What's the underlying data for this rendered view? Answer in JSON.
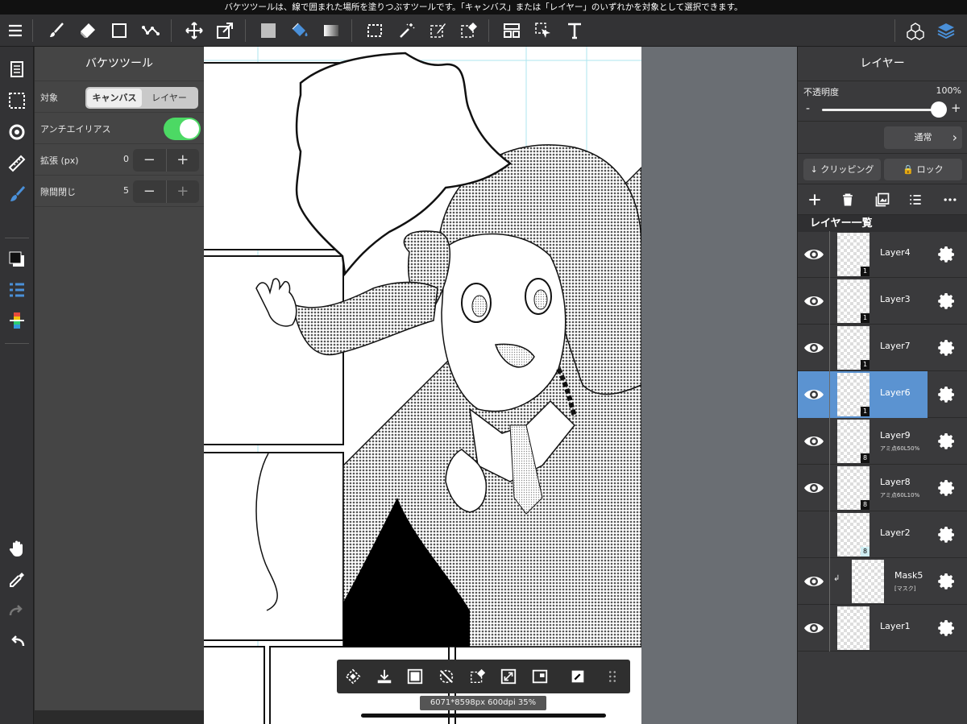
{
  "tooltip": "バケツツールは、線で囲まれた場所を塗りつぶすツールです。「キャンバス」または「レイヤー」のいずれかを対象として選択できます。",
  "tool_panel": {
    "title": "バケツツール",
    "target_label": "対象",
    "target_options": [
      "キャンバス",
      "レイヤー"
    ],
    "target_selected": "キャンバス",
    "antialias_label": "アンチエイリアス",
    "antialias_on": true,
    "expand_label": "拡張 (px)",
    "expand_value": "0",
    "gap_label": "隙間閉じ",
    "gap_value": "5",
    "minus": "−",
    "plus": "+"
  },
  "canvas_info": "6071*8598px 600dpi 35%",
  "layer_panel": {
    "title": "レイヤー",
    "opacity_label": "不透明度",
    "opacity_value": "100%",
    "opacity_fraction": 1.0,
    "minus": "-",
    "plus": "+",
    "blend_mode": "通常",
    "clipping_label": "クリッピング",
    "lock_label": "ロック",
    "list_title": "レイヤー一覧",
    "layers": [
      {
        "name": "Layer4",
        "sub": "",
        "badge": "1",
        "visible": true,
        "selected": false
      },
      {
        "name": "Layer3",
        "sub": "",
        "badge": "1",
        "visible": true,
        "selected": false
      },
      {
        "name": "Layer7",
        "sub": "",
        "badge": "1",
        "visible": true,
        "selected": false
      },
      {
        "name": "Layer6",
        "sub": "",
        "badge": "1",
        "visible": true,
        "selected": true
      },
      {
        "name": "Layer9",
        "sub": "アミ点60L50%",
        "badge": "8",
        "visible": true,
        "selected": false
      },
      {
        "name": "Layer8",
        "sub": "アミ点60L10%",
        "badge": "8",
        "visible": true,
        "selected": false
      },
      {
        "name": "Layer2",
        "sub": "",
        "badge": "8",
        "visible": false,
        "selected": false
      },
      {
        "name": "Mask5",
        "sub": "[マスク]",
        "badge": "",
        "visible": true,
        "selected": false
      },
      {
        "name": "Layer1",
        "sub": "",
        "badge": "",
        "visible": true,
        "selected": false
      }
    ]
  },
  "icons": {
    "toolbar": [
      "menu-icon",
      "brush-icon",
      "eraser-icon",
      "rectangle-icon",
      "polyline-icon",
      "move-icon",
      "transform-icon",
      "fill-color-icon",
      "bucket-icon",
      "gradient-icon",
      "select-rect-icon",
      "magic-wand-icon",
      "select-pen-icon",
      "select-eraser-icon",
      "frame-divide-icon",
      "select-arrow-icon",
      "text-icon",
      "materials-icon",
      "layers-icon"
    ],
    "accent": "#5b93d1",
    "toggle_on": "#4cd964"
  }
}
